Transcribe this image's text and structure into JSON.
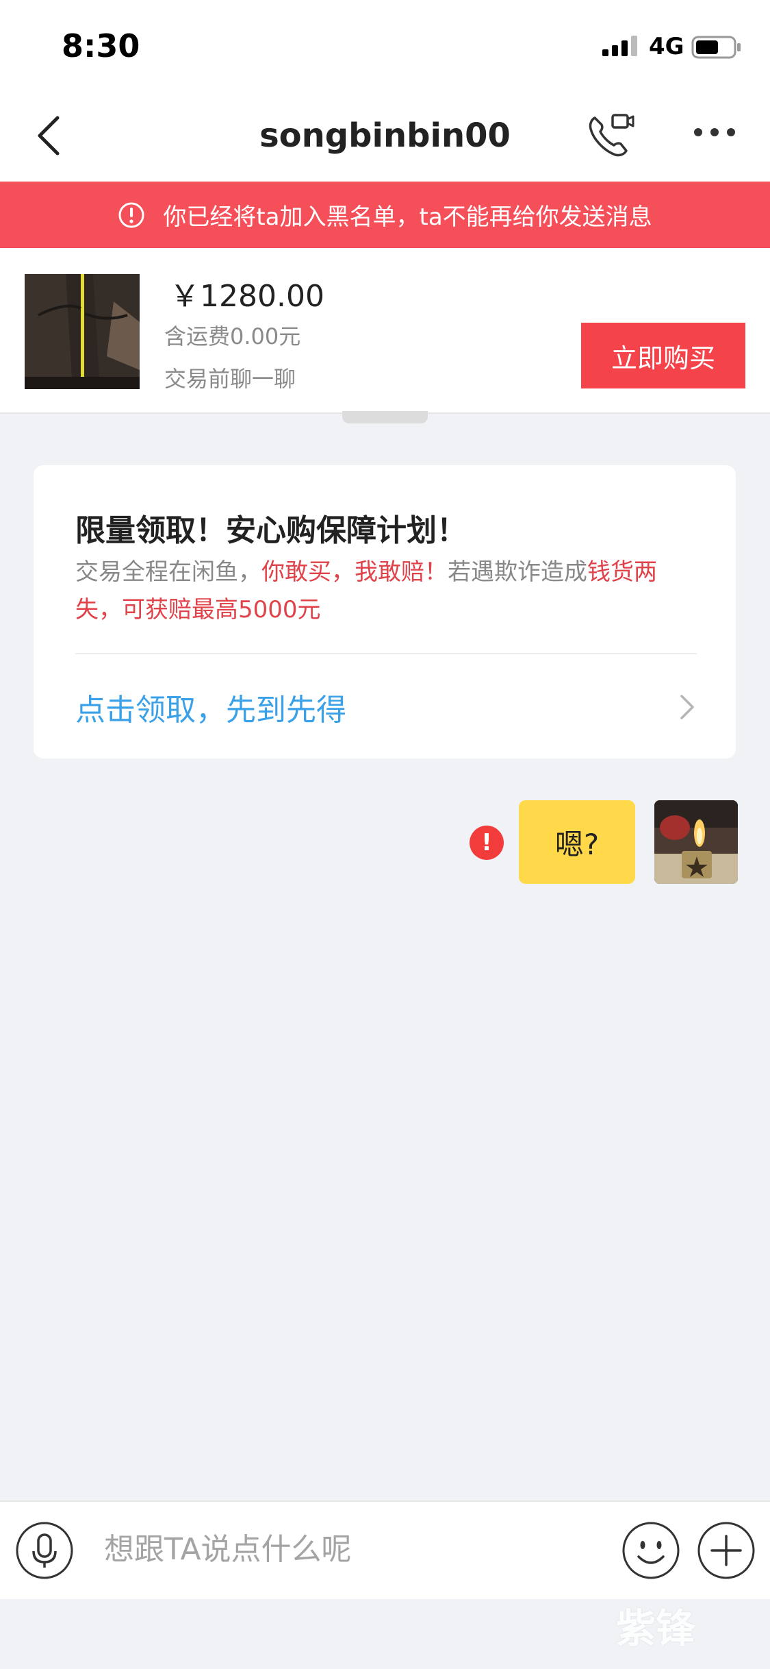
{
  "status_bar": {
    "time": "8:30",
    "network": "4G"
  },
  "header": {
    "title": "songbinbin00"
  },
  "banner": {
    "text": "你已经将ta加入黑名单，ta不能再给你发送消息"
  },
  "product": {
    "price": "￥1280.00",
    "shipping": "含运费0.00元",
    "note": "交易前聊一聊",
    "buy_label": "立即购买"
  },
  "promo": {
    "title": "限量领取！安心购保障计划！",
    "desc_gray_1": "交易全程在闲鱼，",
    "desc_red_1": "你敢买，我敢赔！",
    "desc_gray_2": "若遇欺诈造成",
    "desc_red_2": "钱货两失，可获赔最高5000元",
    "link": "点击领取，先到先得"
  },
  "message": {
    "text": "嗯?",
    "error_mark": "!"
  },
  "input": {
    "placeholder": "想跟TA说点什么呢"
  },
  "watermark": {
    "text": "紫锋"
  },
  "colors": {
    "banner_bg": "#f5505a",
    "buy_btn": "#f5434b",
    "bubble": "#ffd94a",
    "link": "#3aa1e8"
  }
}
